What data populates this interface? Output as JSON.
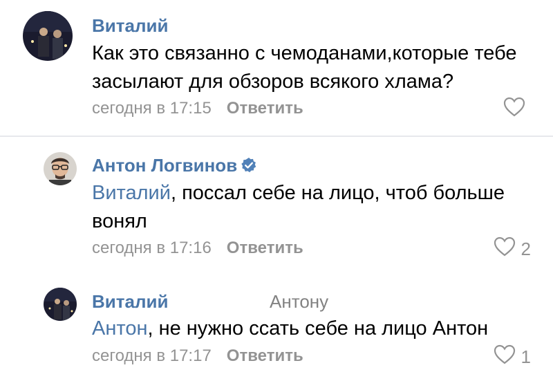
{
  "comments": [
    {
      "author": "Виталий",
      "text": "Как это связанно с чемоданами,которые тебе засылают для обзоров всякого хлама?",
      "time": "сегодня в 17:15",
      "reply_label": "Ответить",
      "likes": ""
    },
    {
      "author": "Антон Логвинов",
      "mention": "Виталий",
      "text": ", поссал себе на лицо, чтоб больше вонял",
      "time": "сегодня в 17:16",
      "reply_label": "Ответить",
      "likes": "2",
      "verified_icon": "verified-check-icon"
    },
    {
      "author": "Виталий",
      "reply_to": "Антону",
      "mention": "Антон",
      "text": ", не нужно ссать себе на лицо Антон",
      "time": "сегодня в 17:17",
      "reply_label": "Ответить",
      "likes": "1"
    }
  ],
  "colors": {
    "link": "#4a76a8",
    "meta": "#939393",
    "divider": "#e7e8ec",
    "verified": "#5181b8"
  }
}
